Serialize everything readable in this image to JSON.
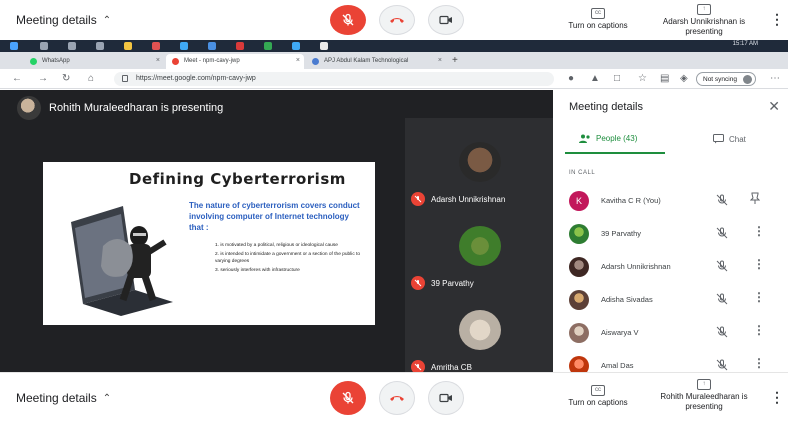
{
  "top_bar": {
    "meeting_details": "Meeting details",
    "captions": "Turn on captions",
    "presenting": "Adarsh Unnikrishnan is presenting"
  },
  "taskbar": {
    "time": "15:17 AM"
  },
  "browser": {
    "tabs": [
      {
        "label": "WhatsApp"
      },
      {
        "label": "Meet - npm-cavy-jwp"
      },
      {
        "label": "APJ Abdul Kalam Technological"
      }
    ],
    "url": "https://meet.google.com/npm-cavy-jwp",
    "sync_label": "Not syncing"
  },
  "stage": {
    "presenter_text": "Rohith Muraleedharan is presenting",
    "slide": {
      "title": "Defining Cyberterrorism",
      "lead": "The nature of cyberterrorism covers conduct involving computer of Internet technology that :",
      "bullets": [
        "1. is motivated by a political, religious or ideological cause",
        "2. is intended to intimidate a government or a section of the public to varying degrees",
        "3. seriously interferes with infrastructure"
      ]
    },
    "tiles": [
      {
        "name": "Adarsh Unnikrishnan"
      },
      {
        "name": "39 Parvathy"
      },
      {
        "name": "Amritha CB"
      }
    ]
  },
  "panel": {
    "title": "Meeting details",
    "people_tab": "People (43)",
    "chat_tab": "Chat",
    "section": "IN CALL",
    "people": [
      {
        "name": "Kavitha C R (You)",
        "initial": "K",
        "color": "#c2185b"
      },
      {
        "name": "39 Parvathy",
        "initial": "",
        "color": "#2e7d32"
      },
      {
        "name": "Adarsh Unnikrishnan",
        "initial": "",
        "color": "#4e342e"
      },
      {
        "name": "Adisha Sivadas",
        "initial": "",
        "color": "#6d4c41"
      },
      {
        "name": "Aiswarya V",
        "initial": "",
        "color": "#8d6e63"
      },
      {
        "name": "Amal Das",
        "initial": "",
        "color": "#bf360c"
      }
    ]
  },
  "bottom_bar": {
    "meeting_details": "Meeting details",
    "captions": "Turn on captions",
    "presenting": "Rohith Muraleedharan is presenting"
  },
  "colors": {
    "accent_red": "#ea4335",
    "accent_green": "#1e8e3e"
  }
}
